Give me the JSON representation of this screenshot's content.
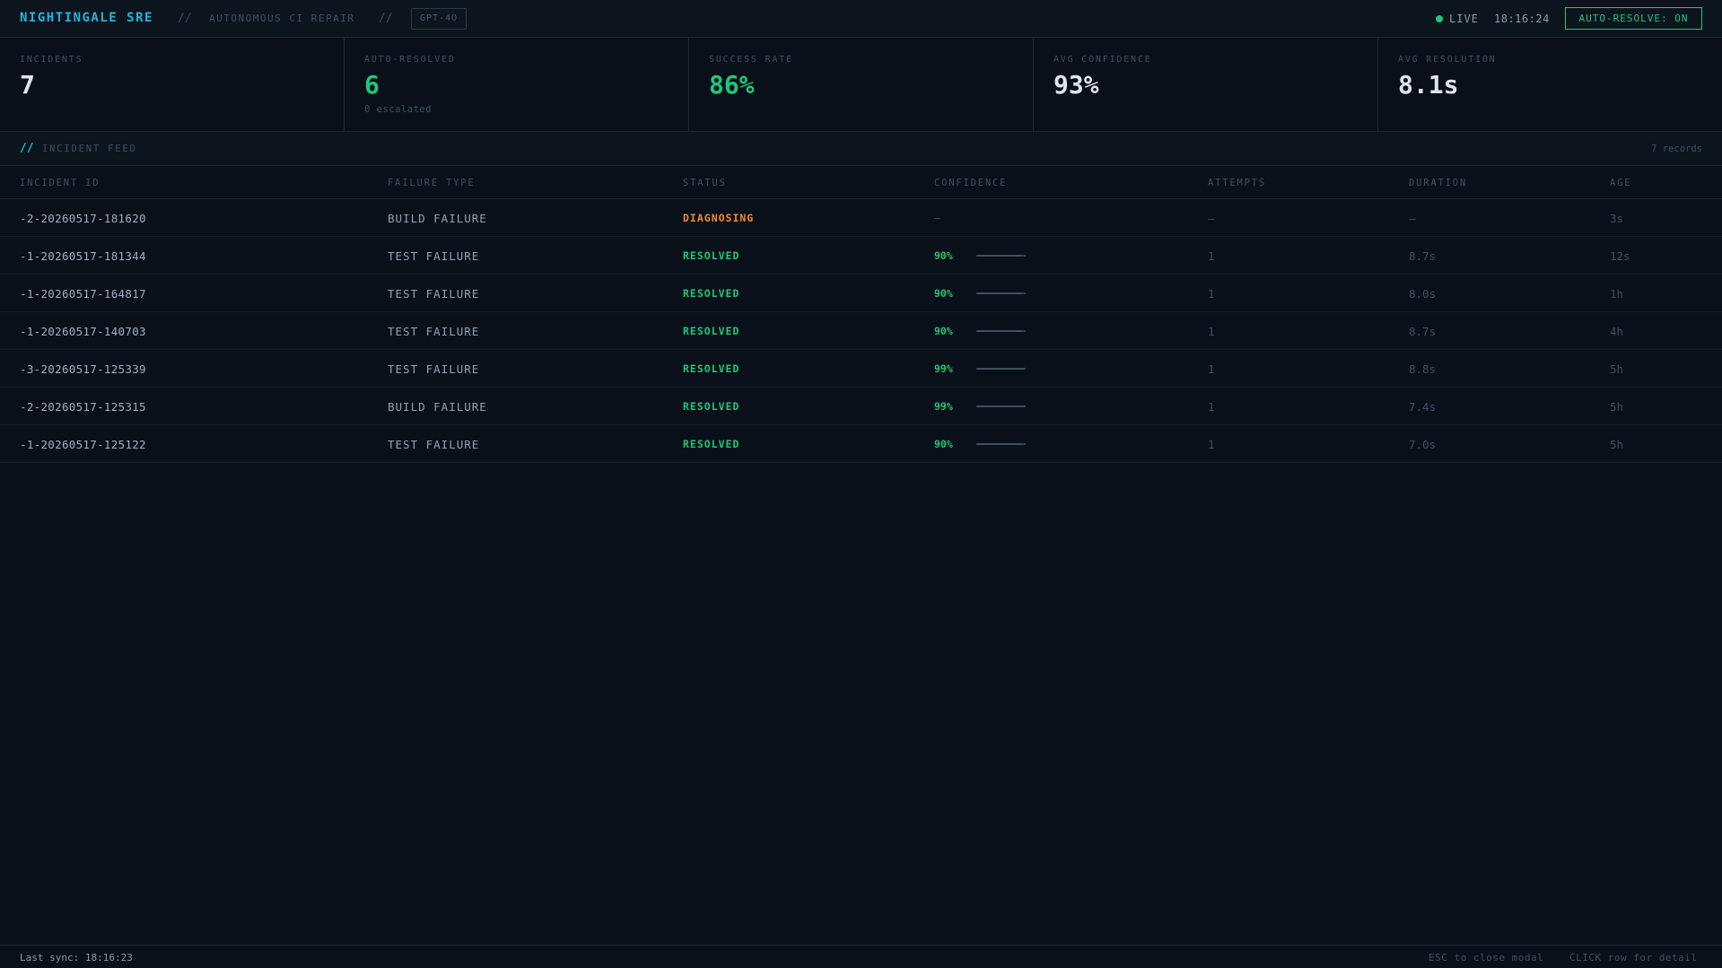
{
  "header": {
    "brand": "NIGHTINGALE SRE",
    "separator": "//",
    "subtitle": "AUTONOMOUS CI REPAIR",
    "model": "GPT-4O",
    "live_label": "LIVE",
    "clock": "18:16:24",
    "auto_resolve_label": "AUTO-RESOLVE: ON",
    "live_color": "#1fc77a"
  },
  "stats": [
    {
      "label": "INCIDENTS",
      "value": "7",
      "sub": ""
    },
    {
      "label": "AUTO-RESOLVED",
      "value": "6",
      "sub": "0 escalated"
    },
    {
      "label": "SUCCESS RATE",
      "value": "86%",
      "sub": ""
    },
    {
      "label": "AVG CONFIDENCE",
      "value": "93%",
      "sub": ""
    },
    {
      "label": "AVG RESOLUTION",
      "value": "8.1s",
      "sub": ""
    }
  ],
  "feed": {
    "prefix": "//",
    "title": "INCIDENT FEED",
    "count": "7 records"
  },
  "columns": [
    "INCIDENT ID",
    "FAILURE TYPE",
    "STATUS",
    "CONFIDENCE",
    "ATTEMPTS",
    "DURATION",
    "AGE"
  ],
  "rows": [
    {
      "id": "-2-20260517-181620",
      "type": "BUILD FAILURE",
      "status": "DIAGNOSING",
      "confidence": "—",
      "confidence_value": null,
      "attempts": "—",
      "duration": "—",
      "age": "3s"
    },
    {
      "id": "-1-20260517-181344",
      "type": "TEST FAILURE",
      "status": "RESOLVED",
      "confidence": "90%",
      "confidence_value": 0.9,
      "attempts": "1",
      "duration": "8.7s",
      "age": "12s"
    },
    {
      "id": "-1-20260517-164817",
      "type": "TEST FAILURE",
      "status": "RESOLVED",
      "confidence": "90%",
      "confidence_value": 0.9,
      "attempts": "1",
      "duration": "8.0s",
      "age": "1h"
    },
    {
      "id": "-1-20260517-140703",
      "type": "TEST FAILURE",
      "status": "RESOLVED",
      "confidence": "90%",
      "confidence_value": 0.9,
      "attempts": "1",
      "duration": "8.7s",
      "age": "4h"
    },
    {
      "id": "-3-20260517-125339",
      "type": "TEST FAILURE",
      "status": "RESOLVED",
      "confidence": "99%",
      "confidence_value": 0.99,
      "attempts": "1",
      "duration": "8.8s",
      "age": "5h"
    },
    {
      "id": "-2-20260517-125315",
      "type": "BUILD FAILURE",
      "status": "RESOLVED",
      "confidence": "99%",
      "confidence_value": 0.99,
      "attempts": "1",
      "duration": "7.4s",
      "age": "5h"
    },
    {
      "id": "-1-20260517-125122",
      "type": "TEST FAILURE",
      "status": "RESOLVED",
      "confidence": "90%",
      "confidence_value": 0.9,
      "attempts": "1",
      "duration": "7.0s",
      "age": "5h"
    }
  ],
  "footer": {
    "last_sync": "Last sync: 18:16:23",
    "hint_esc": "ESC to close modal",
    "hint_click": "CLICK row for detail"
  },
  "colors": {
    "accent": "#22b7d9",
    "resolved": "#1fc77a",
    "diagnosing": "#f08b28",
    "background": "#0a1019"
  }
}
